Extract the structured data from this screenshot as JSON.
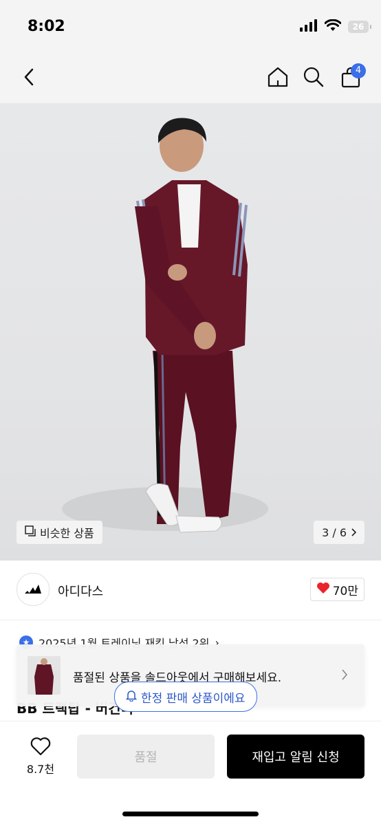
{
  "status_bar": {
    "time": "8:02",
    "battery": "26"
  },
  "nav": {
    "cart_count": "4"
  },
  "gallery": {
    "similar_label": "비슷한 상품",
    "page_indicator": "3 / 6"
  },
  "brand": {
    "name": "아디다스",
    "likes": "70만"
  },
  "ranking": {
    "text": "2025년 1월 트레이닝 재킷 남성 2위"
  },
  "product": {
    "title": "BB 트랙탑 - 버건디"
  },
  "soldout_banner": {
    "text": "품절된 상품을 솔드아웃에서 구매해보세요."
  },
  "limited_tag": {
    "text": "한정 판매 상품이에요"
  },
  "bottom_bar": {
    "wish_count": "8.7천",
    "soldout_label": "품절",
    "restock_label": "재입고 알림 신청"
  },
  "colors": {
    "accent_blue": "#3a6fe8",
    "heart_red": "#e8252e",
    "button_black": "#000000",
    "jacket_burgundy": "#6b1628"
  }
}
